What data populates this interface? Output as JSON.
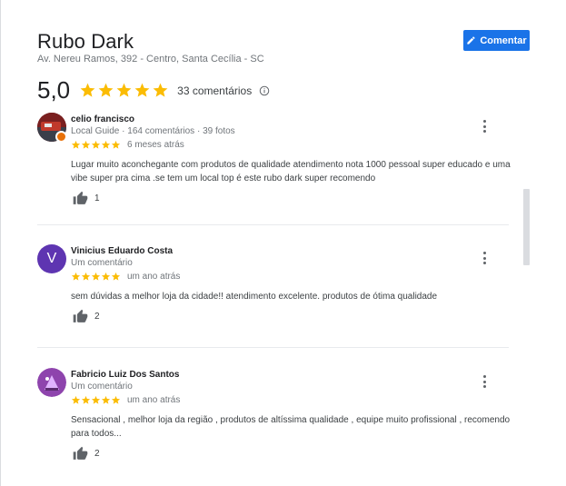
{
  "place": {
    "title": "Rubo Dark",
    "address": "Av. Nereu Ramos, 392 - Centro, Santa Cecília - SC"
  },
  "actions": {
    "comment_label": "Comentar"
  },
  "summary": {
    "rating": "5,0",
    "stars": 5,
    "count_label": "33 comentários"
  },
  "colors": {
    "accent": "#1a73e8",
    "star": "#fbbc04",
    "avatar_purple": "#5e35b1",
    "guide_badge": "#e8710a"
  },
  "reviews": [
    {
      "name": "celio francisco",
      "meta": "Local Guide · 164 comentários · 39 fotos",
      "stars": 5,
      "time": "6 meses atrás",
      "text": "Lugar muito aconchegante com produtos de qualidade atendimento nota 1000 pessoal super educado e uma vibe super pra cima .se tem um local top é este rubo dark super recomendo",
      "likes": "1",
      "avatar": "photo"
    },
    {
      "name": "Vinicius Eduardo Costa",
      "meta": "Um comentário",
      "stars": 5,
      "time": "um ano atrás",
      "text": "sem dúvidas a melhor loja da cidade!! atendimento excelente. produtos de ótima qualidade",
      "likes": "2",
      "avatar_letter": "V"
    },
    {
      "name": "Fabricio Luiz Dos Santos",
      "meta": "Um comentário",
      "stars": 5,
      "time": "um ano atrás",
      "text": "Sensacional , melhor loja da região , produtos de altíssima qualidade , equipe muito profissional , recomendo para todos...",
      "likes": "2",
      "avatar": "illustration"
    }
  ]
}
